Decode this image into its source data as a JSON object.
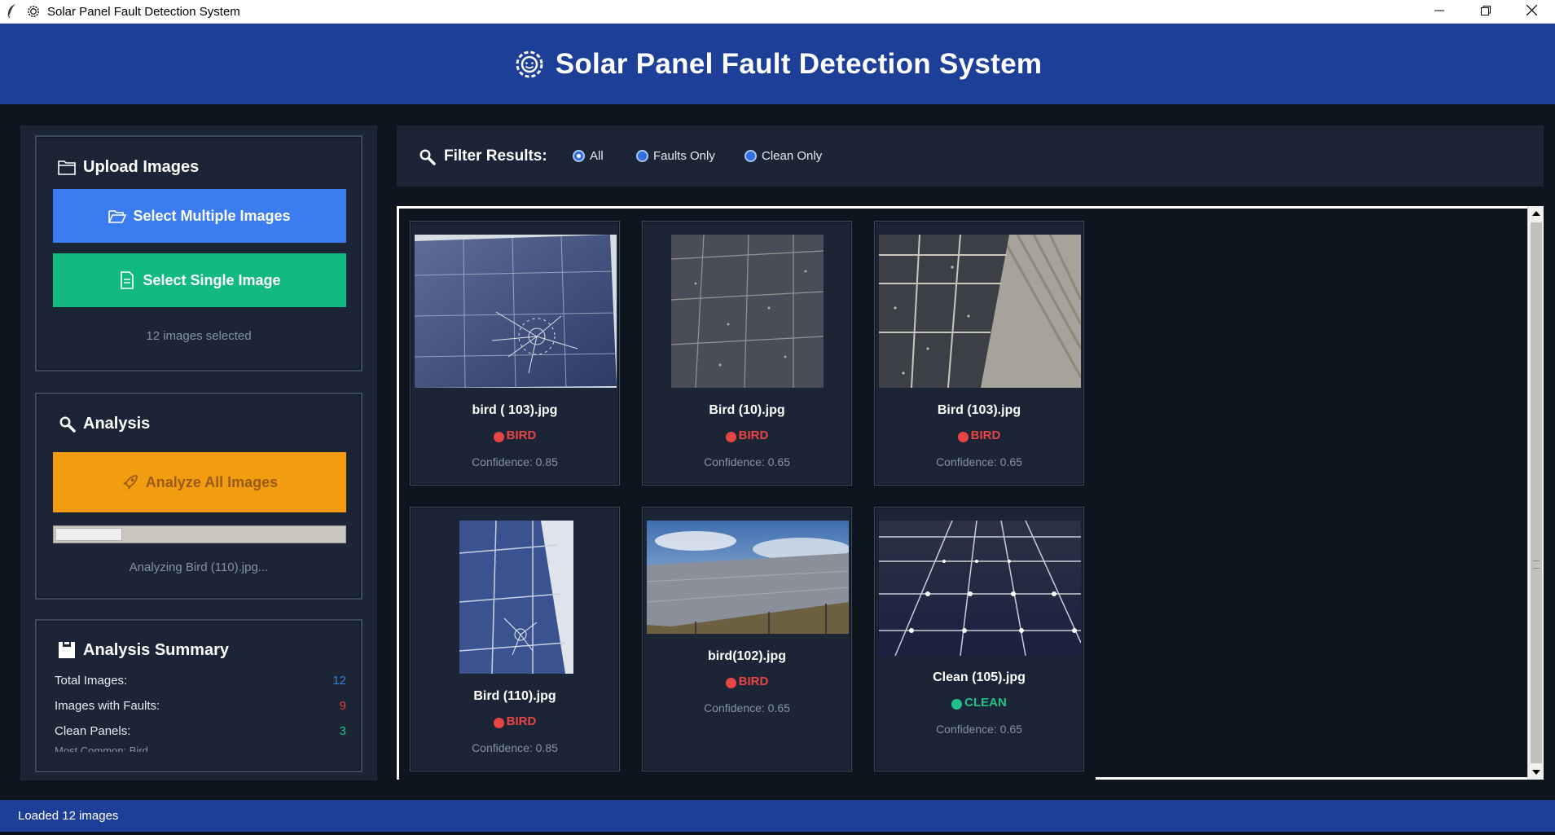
{
  "window": {
    "title": "Solar Panel Fault Detection System",
    "controls": [
      "minimize-icon",
      "restore-icon",
      "close-icon"
    ]
  },
  "header": {
    "title": "Solar Panel Fault Detection System",
    "icon": "sun-gear-icon"
  },
  "upload": {
    "title": "Upload Images",
    "multiple_label": "Select Multiple Images",
    "single_label": "Select Single Image",
    "selected_text": "12 images selected"
  },
  "analysis": {
    "title": "Analysis",
    "analyze_label": "Analyze All Images",
    "progress_fraction": 0.23,
    "progress_text": "Analyzing Bird (110).jpg..."
  },
  "summary": {
    "title": "Analysis Summary",
    "rows": [
      {
        "label": "Total Images:",
        "value": "12",
        "color": "#3a7bd5"
      },
      {
        "label": "Images with Faults:",
        "value": "9",
        "color": "#e04040"
      },
      {
        "label": "Clean Panels:",
        "value": "3",
        "color": "#22c08a"
      }
    ],
    "partial_row": "Most Common: Bird"
  },
  "filter": {
    "label": "Filter Results:",
    "options": [
      {
        "label": "All",
        "selected": true
      },
      {
        "label": "Faults Only",
        "selected": false
      },
      {
        "label": "Clean Only",
        "selected": false
      }
    ]
  },
  "results": [
    {
      "filename": "bird ( 103).jpg",
      "status": "BIRD",
      "confidence": "Confidence: 0.85",
      "status_color": "#e84545"
    },
    {
      "filename": "Bird (10).jpg",
      "status": "BIRD",
      "confidence": "Confidence: 0.65",
      "status_color": "#e84545"
    },
    {
      "filename": "Bird (103).jpg",
      "status": "BIRD",
      "confidence": "Confidence: 0.65",
      "status_color": "#e84545"
    },
    {
      "filename": "Bird (110).jpg",
      "status": "BIRD",
      "confidence": "Confidence: 0.85",
      "status_color": "#e84545"
    },
    {
      "filename": "bird(102).jpg",
      "status": "BIRD",
      "confidence": "Confidence: 0.65",
      "status_color": "#e84545"
    },
    {
      "filename": "Clean (105).jpg",
      "status": "CLEAN",
      "confidence": "Confidence: 0.65",
      "status_color": "#22c08a"
    }
  ],
  "statusbar": {
    "text": "Loaded 12 images"
  },
  "colors": {
    "header_bg": "#1e3f98",
    "panel_bg": "#1b2535",
    "app_bg": "#0e151f",
    "btn_blue": "#3b7df0",
    "btn_green": "#12b981",
    "btn_orange": "#f29d0f",
    "fault_red": "#e84545",
    "clean_green": "#22c08a"
  }
}
